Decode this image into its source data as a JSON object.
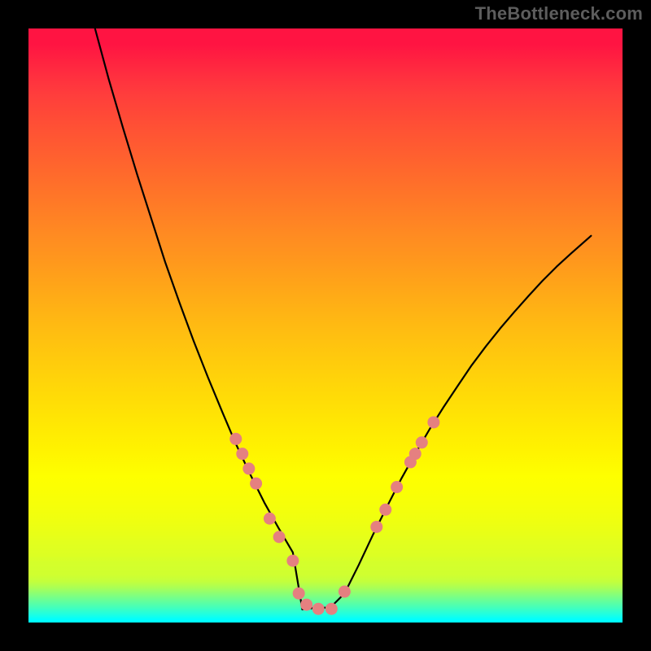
{
  "watermark": "TheBottleneck.com",
  "chart_data": {
    "type": "line",
    "title": "",
    "xlabel": "",
    "ylabel": "",
    "xlim": [
      0,
      100
    ],
    "ylim": [
      0,
      100
    ],
    "series": [
      {
        "name": "main-curve",
        "x": [
          11.2,
          13.5,
          15.9,
          18.3,
          20.7,
          23.0,
          25.4,
          27.8,
          30.2,
          32.6,
          34.9,
          37.3,
          39.7,
          42.1,
          44.5,
          46.1,
          48.4,
          50.8,
          53.2,
          55.6,
          58.0,
          60.4,
          62.7,
          65.1,
          67.5,
          69.9,
          72.3,
          74.6,
          77.0,
          79.4,
          81.8,
          84.2,
          86.5,
          88.9,
          91.3,
          94.7
        ],
        "y": [
          100.0,
          91.5,
          83.3,
          75.4,
          67.9,
          60.7,
          53.9,
          47.4,
          41.3,
          35.5,
          30.1,
          25.0,
          20.2,
          15.9,
          11.8,
          2.2,
          2.5,
          2.5,
          4.9,
          9.7,
          14.8,
          19.6,
          24.1,
          28.4,
          32.5,
          36.3,
          39.9,
          43.3,
          46.5,
          49.5,
          52.3,
          55.0,
          57.5,
          59.9,
          62.1,
          65.1
        ]
      }
    ],
    "markers": [
      {
        "x": 34.9,
        "y": 30.9
      },
      {
        "x": 36.0,
        "y": 28.4
      },
      {
        "x": 37.1,
        "y": 25.9
      },
      {
        "x": 38.3,
        "y": 23.4
      },
      {
        "x": 40.6,
        "y": 17.5
      },
      {
        "x": 42.2,
        "y": 14.4
      },
      {
        "x": 44.5,
        "y": 10.4
      },
      {
        "x": 45.5,
        "y": 4.9
      },
      {
        "x": 46.8,
        "y": 3.0
      },
      {
        "x": 48.8,
        "y": 2.3
      },
      {
        "x": 51.0,
        "y": 2.3
      },
      {
        "x": 53.2,
        "y": 5.2
      },
      {
        "x": 58.6,
        "y": 16.1
      },
      {
        "x": 60.1,
        "y": 19.0
      },
      {
        "x": 62.0,
        "y": 22.8
      },
      {
        "x": 64.3,
        "y": 27.0
      },
      {
        "x": 65.1,
        "y": 28.4
      },
      {
        "x": 66.2,
        "y": 30.3
      },
      {
        "x": 68.2,
        "y": 33.7
      }
    ],
    "marker_color": "#e58080",
    "gradient_stops": [
      {
        "pos": 0.0,
        "color": "#ff1442"
      },
      {
        "pos": 0.026,
        "color": "#ff1442"
      },
      {
        "pos": 0.08,
        "color": "#ff2f3f"
      },
      {
        "pos": 0.113,
        "color": "#ff3e3c"
      },
      {
        "pos": 0.136,
        "color": "#ff4638"
      },
      {
        "pos": 0.17,
        "color": "#ff5234"
      },
      {
        "pos": 0.224,
        "color": "#ff632e"
      },
      {
        "pos": 0.289,
        "color": "#ff7827"
      },
      {
        "pos": 0.345,
        "color": "#ff8a22"
      },
      {
        "pos": 0.389,
        "color": "#ff971d"
      },
      {
        "pos": 0.445,
        "color": "#ffa917"
      },
      {
        "pos": 0.489,
        "color": "#ffb713"
      },
      {
        "pos": 0.545,
        "color": "#ffc70e"
      },
      {
        "pos": 0.6,
        "color": "#ffd609"
      },
      {
        "pos": 0.656,
        "color": "#ffe504"
      },
      {
        "pos": 0.71,
        "color": "#fff300"
      },
      {
        "pos": 0.754,
        "color": "#feff00"
      },
      {
        "pos": 0.776,
        "color": "#fbff03"
      },
      {
        "pos": 0.809,
        "color": "#f4ff0b"
      },
      {
        "pos": 0.832,
        "color": "#eeff11"
      },
      {
        "pos": 0.854,
        "color": "#e7ff18"
      },
      {
        "pos": 0.865,
        "color": "#e2ff1e"
      },
      {
        "pos": 0.887,
        "color": "#dcff23"
      },
      {
        "pos": 0.898,
        "color": "#d5ff2a"
      },
      {
        "pos": 0.92,
        "color": "#cfff30"
      },
      {
        "pos": 0.931,
        "color": "#c3ff3c"
      },
      {
        "pos": 0.942,
        "color": "#a8ff57"
      },
      {
        "pos": 0.953,
        "color": "#85ff7a"
      },
      {
        "pos": 0.964,
        "color": "#64ff9b"
      },
      {
        "pos": 0.975,
        "color": "#43ffbc"
      },
      {
        "pos": 0.986,
        "color": "#20ffe0"
      },
      {
        "pos": 0.995,
        "color": "#00ffff"
      },
      {
        "pos": 1.0,
        "color": "#00ffff"
      }
    ]
  }
}
